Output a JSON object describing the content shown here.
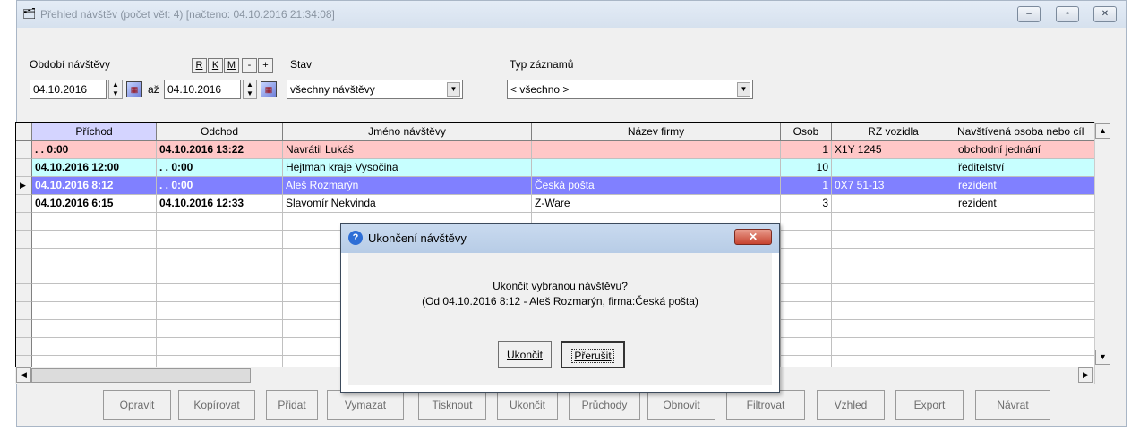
{
  "window": {
    "title": "Přehled návštěv (počet vět: 4)  [načteno: 04.10.2016 21:34:08]",
    "minimize_label": "‒",
    "maximize_label": "▫",
    "close_label": "✕"
  },
  "filters": {
    "period_label": "Období návštěvy",
    "date_from": "04.10.2016",
    "to_label": "až",
    "date_to": "04.10.2016",
    "quick_buttons": [
      "R",
      "K",
      "M",
      "-",
      "+"
    ],
    "status_label": "Stav",
    "status_value": "všechny návštěvy",
    "type_label": "Typ záznamů",
    "type_value": "< všechno >"
  },
  "table": {
    "columns": [
      "Příchod",
      "Odchod",
      "Jméno návštěvy",
      "Název firmy",
      "Osob",
      "RZ vozidla",
      "Navštívená osoba nebo cíl"
    ],
    "rows": [
      {
        "arrival": ". .      0:00",
        "departure": "04.10.2016 13:22",
        "name": "Navrátil Lukáš",
        "company": "",
        "persons": "1",
        "plate": "X1Y 1245",
        "target": "obchodní jednání",
        "color": "#ffc7c7",
        "arrival_bold": true,
        "departure_bold": true
      },
      {
        "arrival": "04.10.2016 12:00",
        "departure": ". .      0:00",
        "name": "Hejtman kraje Vysočina",
        "company": "",
        "persons": "10",
        "plate": "",
        "target": "ředitelství",
        "color": "#c7ffff",
        "arrival_bold": true,
        "departure_bold": true
      },
      {
        "arrival": "04.10.2016  8:12",
        "departure": ". .      0:00",
        "name": "Aleš Rozmarýn",
        "company": "Česká pošta",
        "persons": "1",
        "plate": "0X7 51-13",
        "target": "rezident",
        "color": "#8080ff",
        "arrival_bold": true,
        "departure_bold": true,
        "selected": true
      },
      {
        "arrival": "04.10.2016  6:15",
        "departure": "04.10.2016 12:33",
        "name": "Slavomír Nekvinda",
        "company": "Z-Ware",
        "persons": "3",
        "plate": "",
        "target": "rezident",
        "color": "#ffffff",
        "arrival_bold": true,
        "departure_bold": true
      }
    ]
  },
  "buttons": [
    "Opravit",
    "Kopírovat",
    "Přidat",
    "Vymazat",
    "Tisknout",
    "Ukončit",
    "Průchody",
    "Obnovit",
    "Filtrovat",
    "Vzhled",
    "Export",
    "Návrat"
  ],
  "dialog": {
    "title": "Ukončení návštěvy",
    "message": "Ukončit vybranou návštěvu?",
    "detail": "(Od 04.10.2016  8:12 - Aleš Rozmarýn, firma:Česká pošta)",
    "confirm_label": "Ukončit",
    "cancel_label": "Přerušit",
    "close_label": "✕"
  }
}
